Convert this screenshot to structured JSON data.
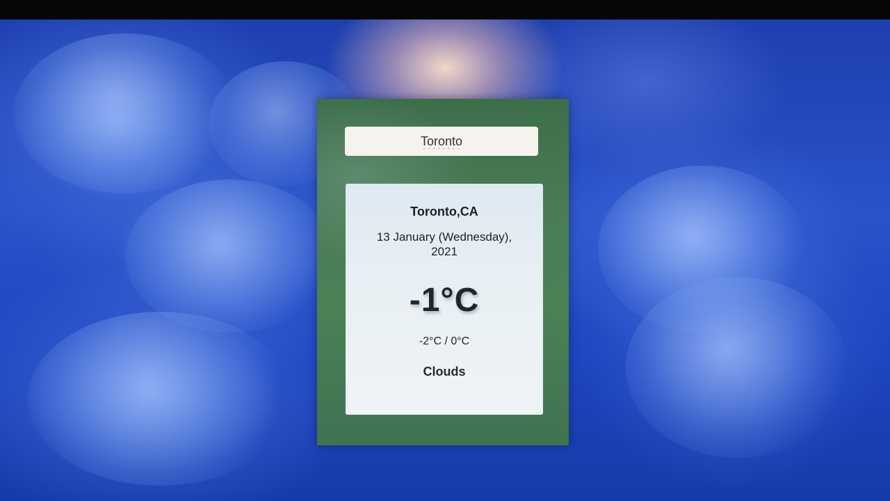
{
  "search": {
    "value": "Toronto"
  },
  "weather": {
    "location": "Toronto,CA",
    "date": "13 January (Wednesday), 2021",
    "temperature": "-1°C",
    "hi_lo": "-2°C / 0°C",
    "condition": "Clouds"
  },
  "colors": {
    "background_sky": "#2a52c9",
    "panel_green": "#4a7d57",
    "card_background": "#e8eff4",
    "text_dark": "#1f1f1f"
  }
}
